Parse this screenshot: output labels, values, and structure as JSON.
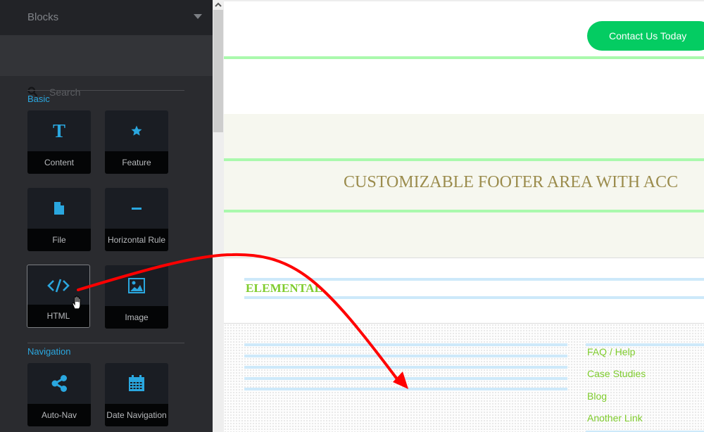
{
  "sidebar": {
    "title": "Blocks",
    "search": {
      "placeholder": "Search",
      "value": ""
    },
    "sections": [
      {
        "label": "Basic",
        "items": [
          {
            "label": "Content",
            "icon": "text-icon"
          },
          {
            "label": "Feature",
            "icon": "star-icon"
          },
          {
            "label": "File",
            "icon": "file-icon"
          },
          {
            "label": "Horizontal Rule",
            "icon": "horizontal-rule-icon"
          },
          {
            "label": "HTML",
            "icon": "code-icon",
            "state": "hovered"
          },
          {
            "label": "Image",
            "icon": "image-icon"
          }
        ]
      },
      {
        "label": "Navigation",
        "items": [
          {
            "label": "Auto-Nav",
            "icon": "share-icon"
          },
          {
            "label": "Date Navigation",
            "icon": "calendar-icon"
          }
        ]
      }
    ]
  },
  "page": {
    "cta_button": "Contact Us Today",
    "footer_heading": "CUSTOMIZABLE FOOTER AREA WITH ACC",
    "brand_text": "ELEMENTAL",
    "footer_links": [
      "FAQ / Help",
      "Case Studies",
      "Blog",
      "Another Link"
    ]
  },
  "annotation": {
    "type": "drag-arrow",
    "from": "HTML block",
    "to": "footer content area",
    "color": "#ff0000"
  },
  "colors": {
    "accent_blue": "#2aa7df",
    "cta_green": "#04cc62",
    "link_green": "#7fcc2d",
    "heading_gold": "#9b8c4d",
    "guide_green": "#aaf9ad",
    "guide_blue": "#cde9fa"
  }
}
